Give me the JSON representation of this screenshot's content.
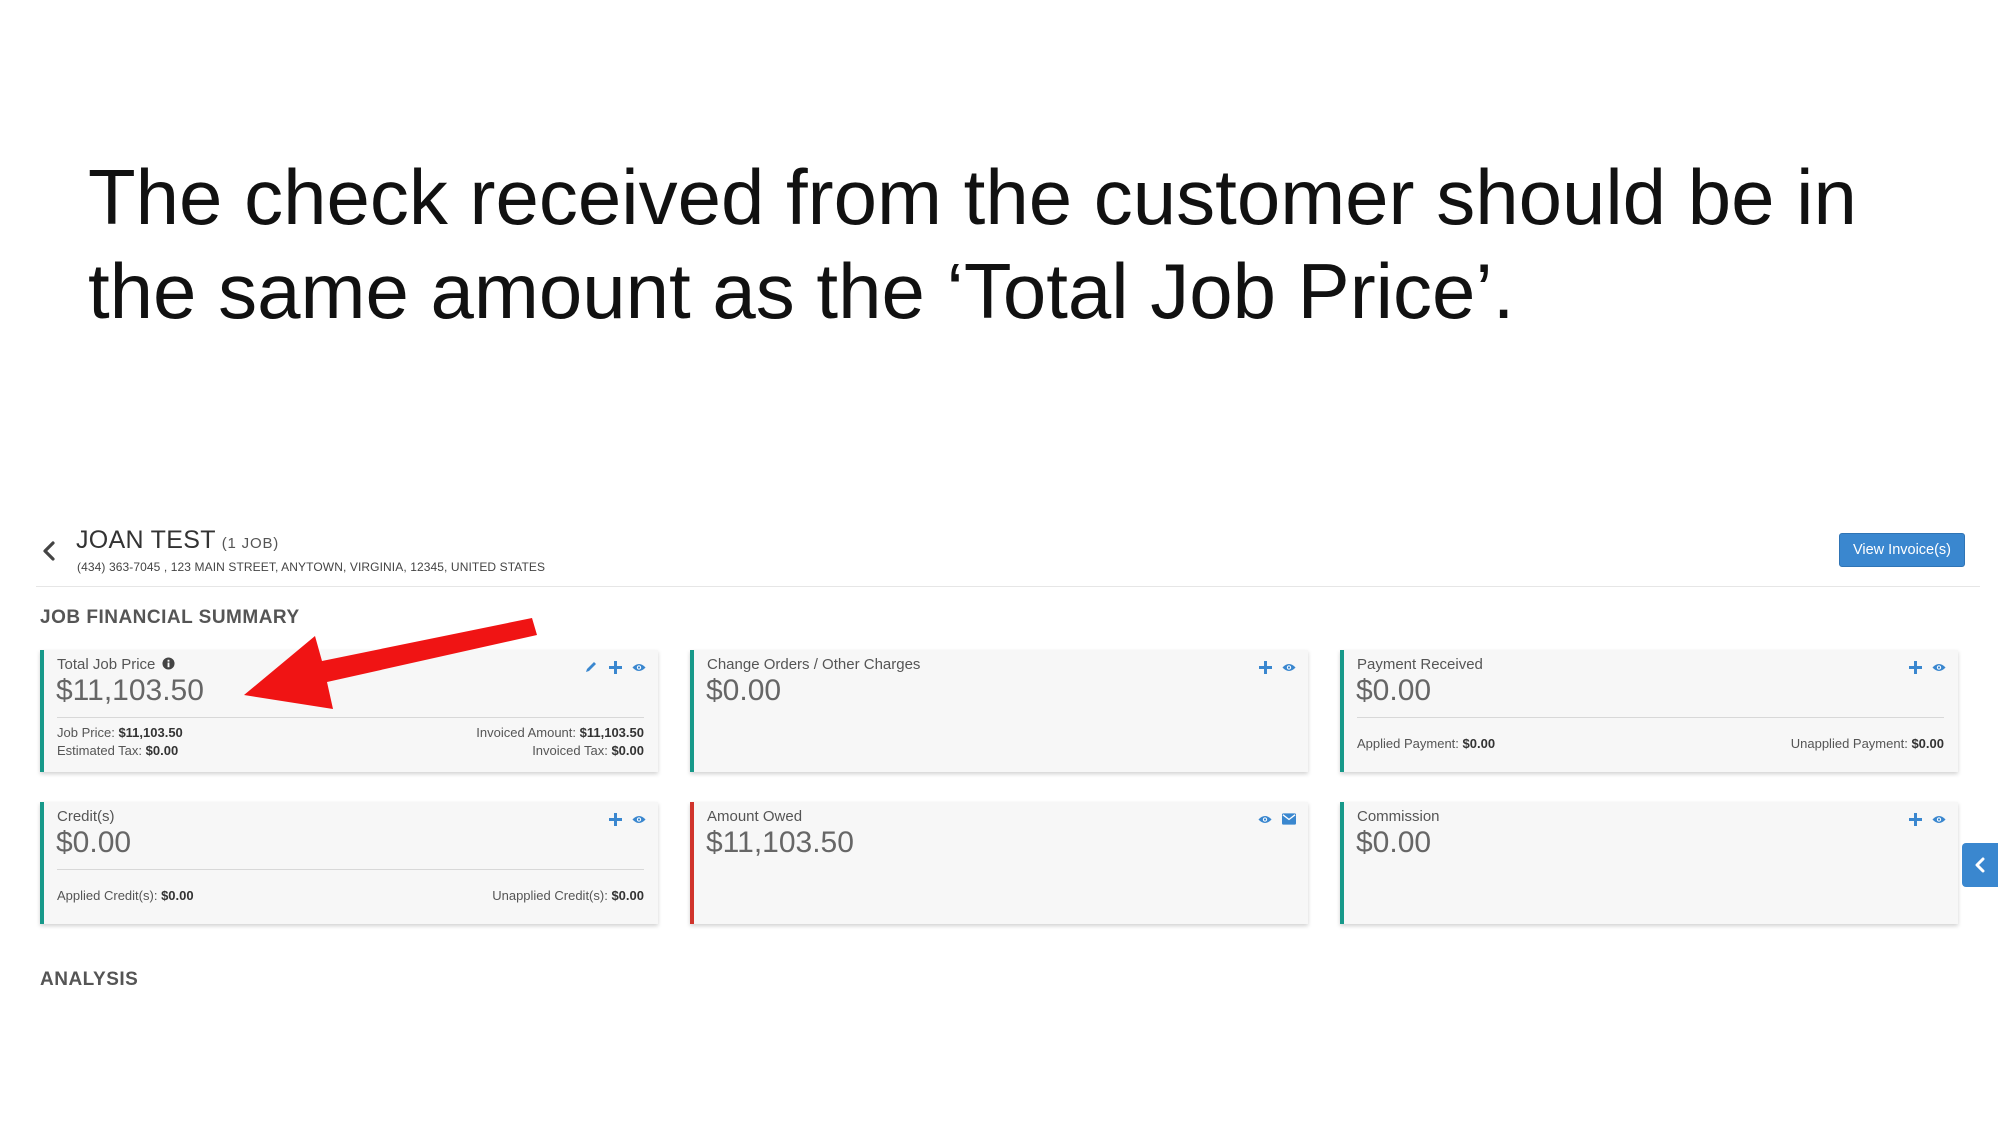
{
  "slide": {
    "title_line1": "The check received from the customer should be in",
    "title_line2": "the same amount as the ‘Total Job Price’."
  },
  "header": {
    "customer_name": "JOAN TEST",
    "job_count": "(1 JOB)",
    "address": "(434) 363-7045 , 123 MAIN STREET, ANYTOWN, VIRGINIA, 12345, UNITED STATES",
    "view_invoices_label": "View Invoice(s)"
  },
  "sections": {
    "financial_summary": "JOB FINANCIAL SUMMARY",
    "analysis": "ANALYSIS"
  },
  "cards": {
    "total_job_price": {
      "label": "Total Job Price",
      "value": "$11,103.50",
      "job_price_label": "Job Price:",
      "job_price": "$11,103.50",
      "estimated_tax_label": "Estimated Tax:",
      "estimated_tax": "$0.00",
      "invoiced_amount_label": "Invoiced Amount:",
      "invoiced_amount": "$11,103.50",
      "invoiced_tax_label": "Invoiced Tax:",
      "invoiced_tax": "$0.00"
    },
    "change_orders": {
      "label": "Change Orders / Other Charges",
      "value": "$0.00"
    },
    "payment_received": {
      "label": "Payment Received",
      "value": "$0.00",
      "applied_label": "Applied Payment:",
      "applied": "$0.00",
      "unapplied_label": "Unapplied Payment:",
      "unapplied": "$0.00"
    },
    "credits": {
      "label": "Credit(s)",
      "value": "$0.00",
      "applied_label": "Applied Credit(s):",
      "applied": "$0.00",
      "unapplied_label": "Unapplied Credit(s):",
      "unapplied": "$0.00"
    },
    "amount_owed": {
      "label": "Amount Owed",
      "value": "$11,103.50"
    },
    "commission": {
      "label": "Commission",
      "value": "$0.00"
    }
  },
  "colors": {
    "accent_teal": "#17998a",
    "accent_red": "#d0342c",
    "action_blue": "#3a87cf",
    "arrow_red": "#f01414"
  },
  "icons": [
    "chevron-left-icon",
    "info-icon",
    "pencil-icon",
    "plus-icon",
    "eye-icon",
    "envelope-icon",
    "arrow-annotation"
  ]
}
